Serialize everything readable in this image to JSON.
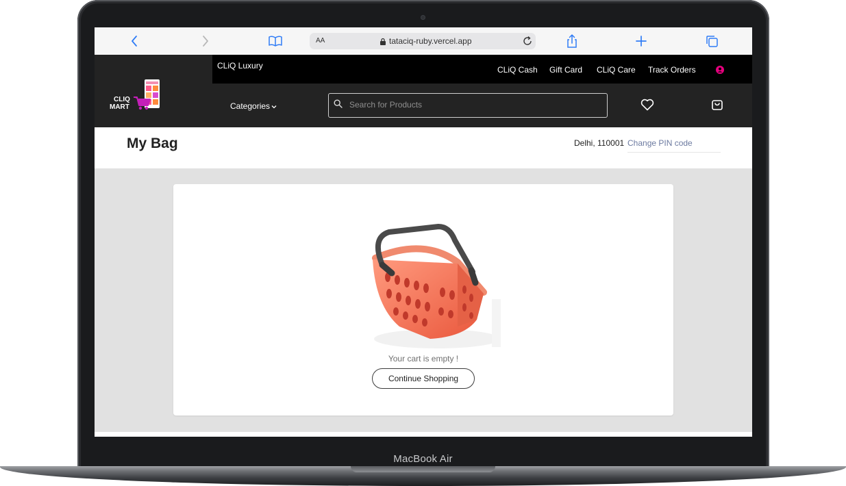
{
  "device": {
    "label": "MacBook Air"
  },
  "browser": {
    "text_size_label": "AA",
    "url": "tataciq-ruby.vercel.app",
    "icons": [
      "back-icon",
      "forward-icon",
      "bookmarks-icon",
      "lock-icon",
      "reload-icon",
      "share-icon",
      "new-tab-icon",
      "tabs-icon"
    ]
  },
  "site": {
    "top_bar": {
      "luxury_label": "CLiQ Luxury",
      "links": [
        "CLiQ Cash",
        "Gift Card",
        "CLiQ Care",
        "Track Orders"
      ],
      "profile_icon": "user-circle-icon",
      "accent_color": "#e6007e"
    },
    "logo": {
      "line1": "CLIQ",
      "line2": "MART"
    },
    "nav": {
      "categories_label": "Categories",
      "search_placeholder": "Search for Products",
      "icons": [
        "heart-icon",
        "bag-icon"
      ]
    }
  },
  "page": {
    "title": "My Bag",
    "pin": {
      "city": "Delhi, 110001",
      "change_label": "Change PIN code"
    }
  },
  "cart": {
    "empty_message": "Your cart is empty !",
    "button_label": "Continue Shopping",
    "image": "empty-basket-illustration"
  }
}
